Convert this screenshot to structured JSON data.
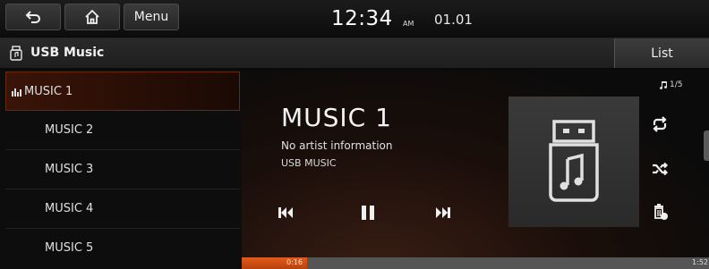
{
  "topbar": {
    "menu_label": "Menu",
    "time": "12:34",
    "ampm": "AM",
    "date": "01.01"
  },
  "source": {
    "title": "USB Music",
    "icon": "usb-drive-icon",
    "list_label": "List"
  },
  "playlist": {
    "items": [
      {
        "label": "MUSIC 1",
        "active": true
      },
      {
        "label": "MUSIC 2",
        "active": false
      },
      {
        "label": "MUSIC 3",
        "active": false
      },
      {
        "label": "MUSIC 4",
        "active": false
      },
      {
        "label": "MUSIC 5",
        "active": false
      }
    ]
  },
  "now_playing": {
    "title": "MUSIC 1",
    "artist": "No artist information",
    "album": "USB MUSIC",
    "track_count": "1/5",
    "elapsed": "0:16",
    "duration": "1:52",
    "progress_fraction": 0.14
  },
  "controls": {
    "prev_icon": "previous-track-icon",
    "play_icon": "pause-icon",
    "next_icon": "next-track-icon",
    "repeat_icon": "repeat-icon",
    "shuffle_icon": "shuffle-icon",
    "delete_icon": "delete-icon"
  },
  "colors": {
    "accent": "#e25a1a",
    "background": "#0a0a0a"
  }
}
